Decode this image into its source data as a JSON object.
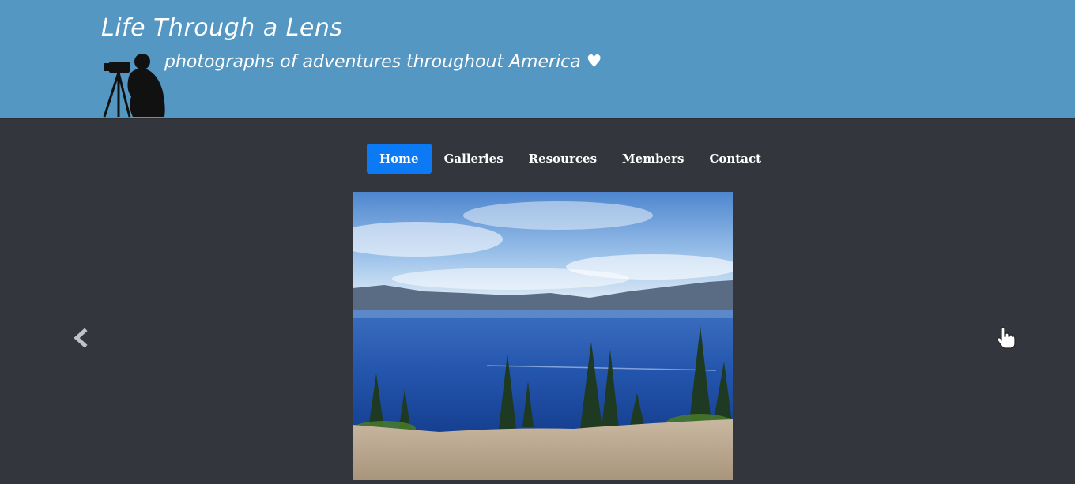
{
  "header": {
    "title": "Life Through a Lens",
    "tagline": "photographs of adventures throughout America ♥",
    "logo_icon": "photographer-silhouette-icon",
    "background_color": "#5597c3"
  },
  "nav": {
    "items": [
      {
        "label": "Home",
        "active": true
      },
      {
        "label": "Galleries",
        "active": false
      },
      {
        "label": "Resources",
        "active": false
      },
      {
        "label": "Members",
        "active": false
      },
      {
        "label": "Contact",
        "active": false
      }
    ],
    "active_color": "#0d7af5"
  },
  "carousel": {
    "prev_icon": "chevron-left-icon",
    "next_icon": "hand-cursor-icon",
    "slide_image": "lake-landscape-photo"
  }
}
